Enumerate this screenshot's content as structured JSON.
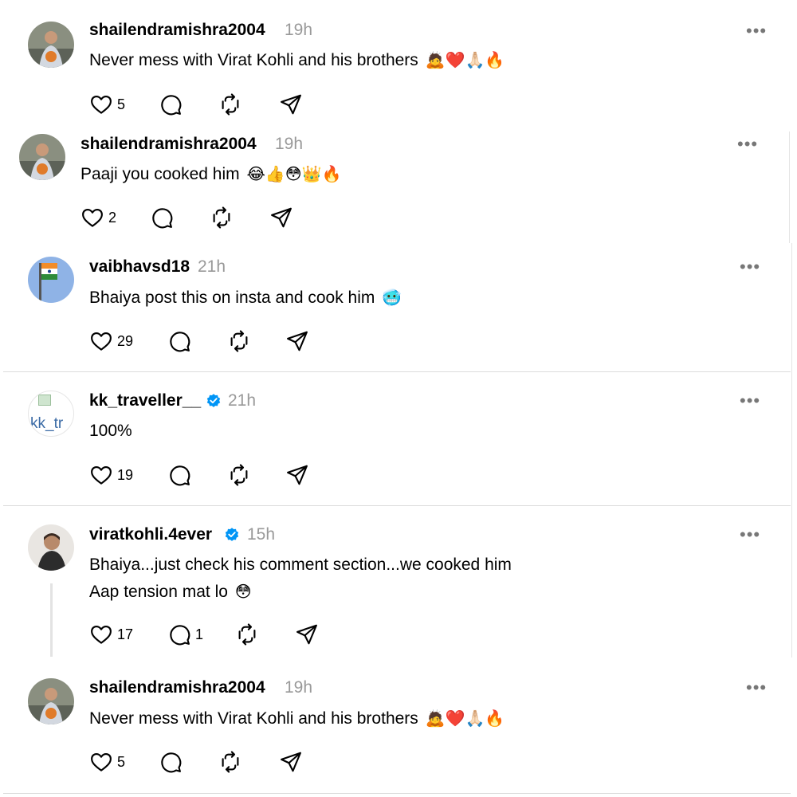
{
  "posts": [
    {
      "username": "shailendramishra2004",
      "time": "19h",
      "verified": false,
      "text": "Never mess with Virat Kohli and his brothers",
      "emojis": "🙇❤️🙏🏻🔥",
      "likes": "5",
      "replies": ""
    },
    {
      "username": "shailendramishra2004",
      "time": "19h",
      "verified": false,
      "text": "Paaji you cooked him",
      "emojis": "😂👍😳👑🔥",
      "likes": "2",
      "replies": ""
    },
    {
      "username": "vaibhavsd18",
      "time": "21h",
      "verified": false,
      "text": "Bhaiya post this on insta and cook him",
      "emojis": "🥶",
      "likes": "29",
      "replies": ""
    },
    {
      "username": "kk_traveller__",
      "time": "21h",
      "verified": true,
      "text": "100%",
      "emojis": "",
      "likes": "19",
      "replies": "",
      "avatar_alt": "kk_tr"
    },
    {
      "username": "viratkohli.4ever",
      "time": "15h",
      "verified": true,
      "text": "Bhaiya...just check his comment section...we cooked him",
      "text2": "Aap tension mat lo",
      "emojis": "😳",
      "likes": "17",
      "replies": "1"
    },
    {
      "username": "shailendramishra2004",
      "time": "19h",
      "verified": false,
      "text": "Never mess with Virat Kohli and his brothers",
      "emojis": "🙇❤️🙏🏻🔥",
      "likes": "5",
      "replies": ""
    }
  ],
  "more_icon": "•••",
  "colors": {
    "verified": "#0095f6",
    "muted": "#999999",
    "divider": "#dbdbdb"
  },
  "icons": [
    "heart-icon",
    "comment-icon",
    "repost-icon",
    "share-icon",
    "verified-icon",
    "more-icon"
  ]
}
